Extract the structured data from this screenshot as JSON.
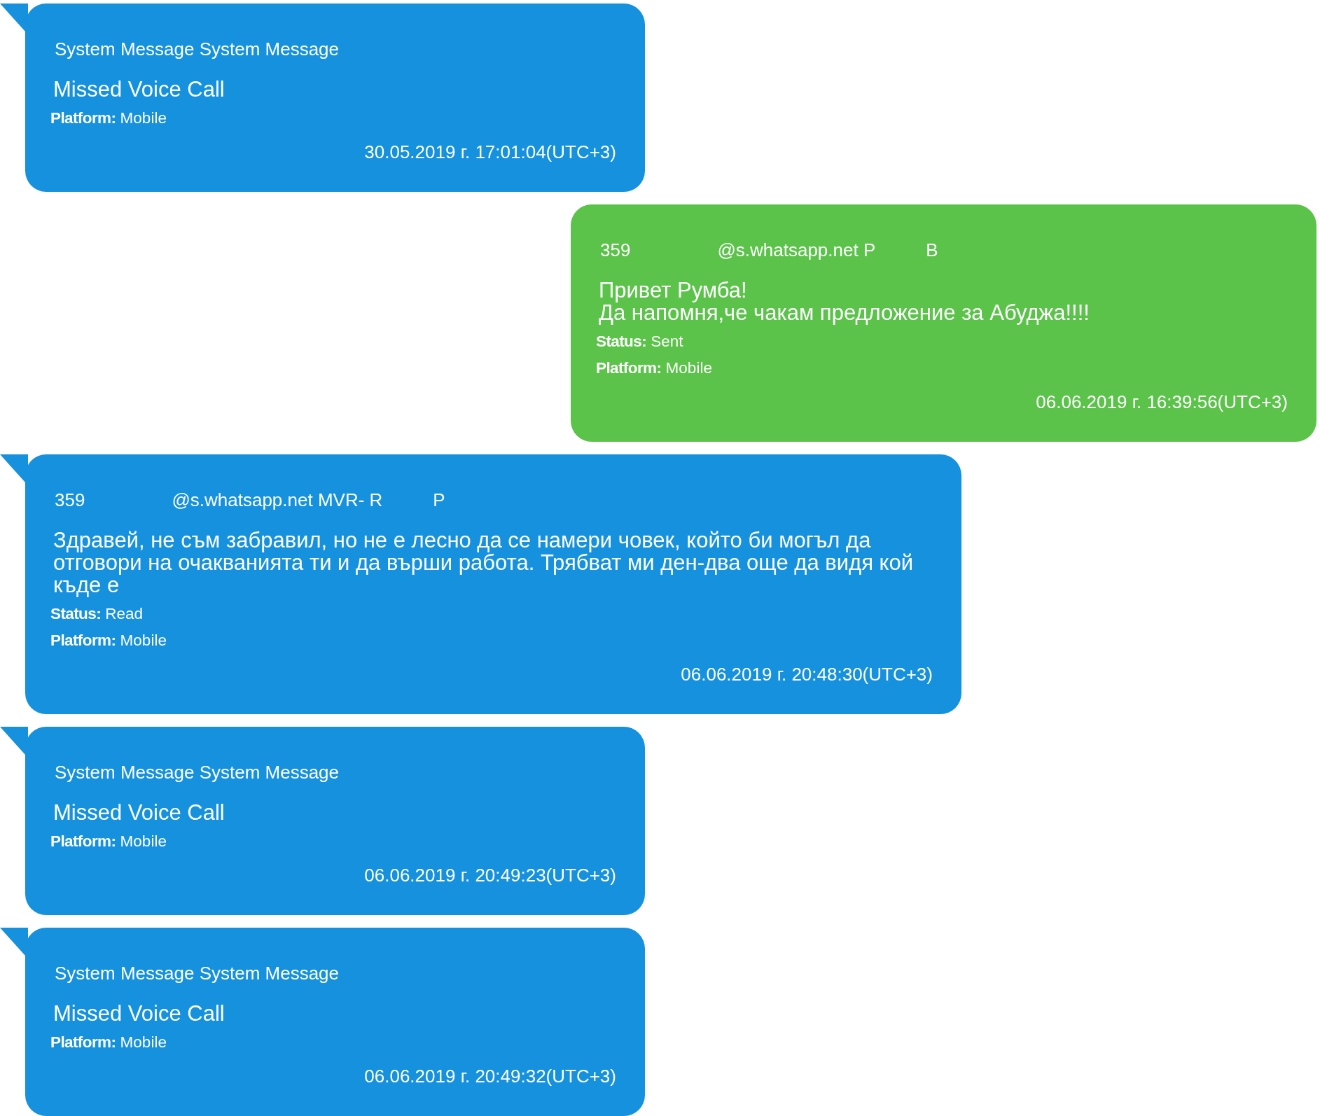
{
  "messages": [
    {
      "kind": "system",
      "outgoing": false,
      "sender": [
        "System Message System Message"
      ],
      "text": "Missed Voice Call",
      "details": [
        {
          "label": "Platform:",
          "value": "Mobile"
        }
      ],
      "timestamp": "30.05.2019 г. 17:01:04(UTC+3)"
    },
    {
      "kind": "text",
      "outgoing": true,
      "sender": [
        "359",
        "@s.whatsapp.net P",
        "B"
      ],
      "text": "Привет Румба!\nДа напомня,че чакам предложение за Абуджа!!!!",
      "details": [
        {
          "label": "Status:",
          "value": "Sent"
        },
        {
          "label": "Platform:",
          "value": "Mobile"
        }
      ],
      "timestamp": "06.06.2019 г. 16:39:56(UTC+3)"
    },
    {
      "kind": "text",
      "outgoing": false,
      "sender": [
        "359",
        "@s.whatsapp.net MVR- R",
        "P"
      ],
      "text": "Здравей, не съм забравил, но не е лесно да се намери човек, който би могъл да отговори на очакванията ти и да върши работа. Трябват ми ден-два още да видя кой къде е",
      "details": [
        {
          "label": "Status:",
          "value": "Read"
        },
        {
          "label": "Platform:",
          "value": "Mobile"
        }
      ],
      "timestamp": "06.06.2019 г. 20:48:30(UTC+3)"
    },
    {
      "kind": "system",
      "outgoing": false,
      "sender": [
        "System Message System Message"
      ],
      "text": "Missed Voice Call",
      "details": [
        {
          "label": "Platform:",
          "value": "Mobile"
        }
      ],
      "timestamp": "06.06.2019 г. 20:49:23(UTC+3)"
    },
    {
      "kind": "system",
      "outgoing": false,
      "sender": [
        "System Message System Message"
      ],
      "text": "Missed Voice Call",
      "details": [
        {
          "label": "Platform:",
          "value": "Mobile"
        }
      ],
      "timestamp": "06.06.2019 г. 20:49:32(UTC+3)"
    }
  ]
}
